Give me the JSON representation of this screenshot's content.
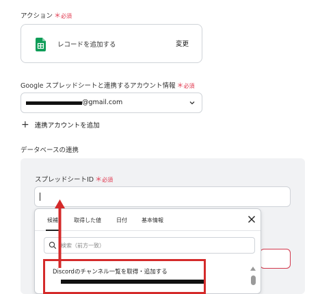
{
  "action_section": {
    "label": "アクション",
    "required_mark": "＊",
    "required_text": "必須",
    "action_name": "レコードを追加する",
    "change_label": "変更",
    "icon": "google-sheets-icon"
  },
  "account_section": {
    "label": "Google スプレッドシートと連携するアカウント情報",
    "required_mark": "＊",
    "required_text": "必須",
    "email_suffix": "@gmail.com",
    "add_account_label": "連携アカウントを追加"
  },
  "database_section": {
    "label": "データベースの連携",
    "spreadsheet_id_label": "スプレッドシートID",
    "required_mark": "＊",
    "required_text": "必須"
  },
  "popup": {
    "tabs": [
      "候補",
      "取得した値",
      "日付",
      "基本情報"
    ],
    "active_tab": 0,
    "search_placeholder": "検索（前方一致）",
    "items": [
      {
        "title": "Discordのチャンネル一覧を取得・追加する"
      }
    ]
  },
  "colors": {
    "required": "#e0334a",
    "highlight": "#d42a2a",
    "panel_bg": "#f1f2f4",
    "sheets_green": "#0f9d58"
  }
}
